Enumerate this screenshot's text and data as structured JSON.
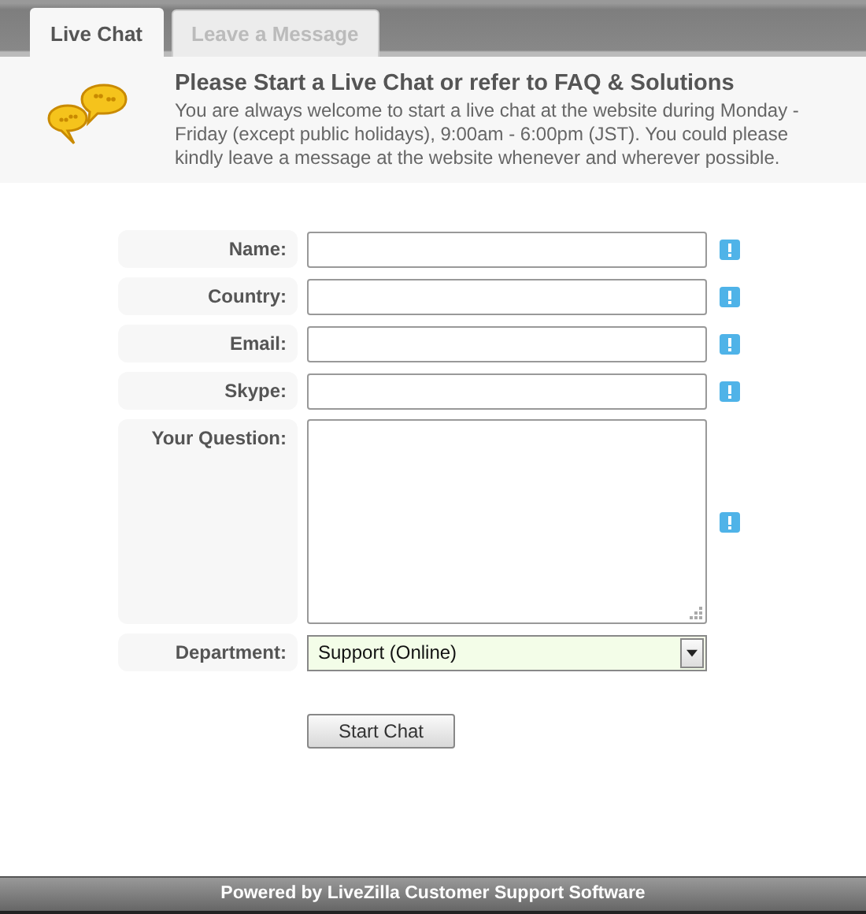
{
  "tabs": [
    {
      "label": "Live Chat",
      "selected": true
    },
    {
      "label": "Leave a Message",
      "selected": false
    }
  ],
  "intro": {
    "title": "Please Start a Live Chat or refer to FAQ & Solutions",
    "text": "You are always welcome to start a live chat at the website during Monday - Friday (except public holidays), 9:00am - 6:00pm (JST). You could please kindly leave a message at the website whenever and wherever possible."
  },
  "fields": [
    {
      "kind": "text",
      "label": "Name:",
      "required": true
    },
    {
      "kind": "text",
      "label": "Country:",
      "required": true
    },
    {
      "kind": "text",
      "label": "Email:",
      "required": true
    },
    {
      "kind": "text",
      "label": "Skype:",
      "required": true
    },
    {
      "kind": "textarea",
      "label": "Your Question:",
      "required": true
    },
    {
      "kind": "select",
      "label": "Department:",
      "value": "Support (Online)",
      "required": false
    }
  ],
  "submit": "Start Chat",
  "footer": "Powered by LiveZilla Customer Support Software"
}
